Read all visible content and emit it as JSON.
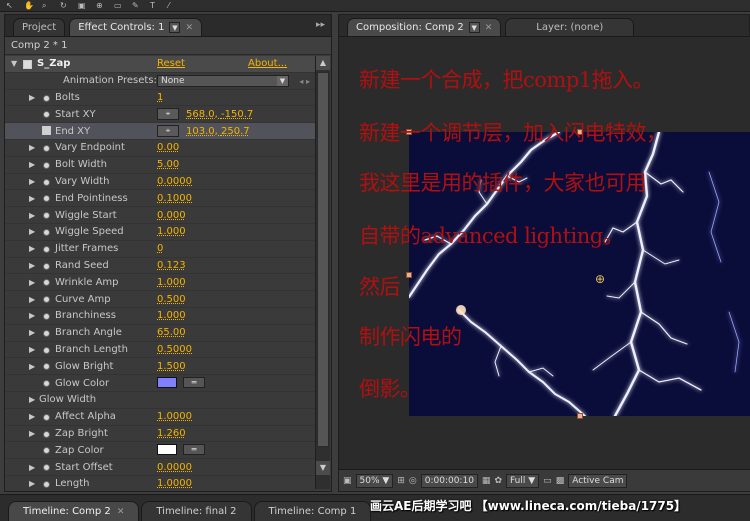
{
  "toolbar": {
    "tools": [
      "select-tool",
      "hand-tool",
      "zoom-tool",
      "rotate-tool",
      "camera-tool",
      "pan-tool",
      "rect-tool",
      "pen-tool",
      "text-tool",
      "brush-tool"
    ]
  },
  "left_panel": {
    "tabs": [
      {
        "label": "Project"
      },
      {
        "label": "Effect Controls: 1"
      }
    ],
    "comp_label": "Comp 2 * 1",
    "effect": {
      "name": "S_Zap",
      "reset": "Reset",
      "about": "About..."
    },
    "presets": {
      "label": "Animation Presets:",
      "value": "None"
    },
    "params": [
      {
        "name": "Bolts",
        "value": "1"
      },
      {
        "name": "Start XY",
        "x": "568.0",
        "y": "-150.7"
      },
      {
        "name": "End XY",
        "x": "103.0",
        "y": "250.7"
      },
      {
        "name": "Vary Endpoint",
        "value": "0.00"
      },
      {
        "name": "Bolt Width",
        "value": "5.00"
      },
      {
        "name": "Vary Width",
        "value": "0.0000"
      },
      {
        "name": "End Pointiness",
        "value": "0.1000"
      },
      {
        "name": "Wiggle Start",
        "value": "0.000"
      },
      {
        "name": "Wiggle Speed",
        "value": "1.000"
      },
      {
        "name": "Jitter Frames",
        "value": "0"
      },
      {
        "name": "Rand Seed",
        "value": "0.123"
      },
      {
        "name": "Wrinkle Amp",
        "value": "1.000"
      },
      {
        "name": "Curve Amp",
        "value": "0.500"
      },
      {
        "name": "Branchiness",
        "value": "1.000"
      },
      {
        "name": "Branch Angle",
        "value": "65.00"
      },
      {
        "name": "Branch Length",
        "value": "0.5000"
      },
      {
        "name": "Glow Bright",
        "value": "1.500"
      },
      {
        "name": "Glow Color",
        "color": "#8080ff"
      },
      {
        "name": "Glow Width"
      },
      {
        "name": "Affect Alpha",
        "value": "1.0000"
      },
      {
        "name": "Zap Bright",
        "value": "1.260"
      },
      {
        "name": "Zap Color",
        "color": "#ffffff"
      },
      {
        "name": "Start Offset",
        "value": "0.0000"
      },
      {
        "name": "Length",
        "value": "1.0000"
      }
    ]
  },
  "right_panel": {
    "tabs": [
      {
        "label": "Composition: Comp 2"
      },
      {
        "label": "Layer: (none)"
      }
    ],
    "overlay_lines": [
      "新建一个合成，把comp1拖入。",
      "新建一个调节层，加入闪电特效，",
      "我这里是用的插件，大家也可用",
      "自带的advanced lighting。",
      "然后",
      "制作闪电的",
      "倒影。"
    ],
    "viewer_bar": {
      "zoom": "50%",
      "timecode": "0:00:00:10",
      "resolution": "Full",
      "camera": "Active Cam"
    }
  },
  "bottom_tabs": [
    {
      "label": "Timeline: Comp 2"
    },
    {
      "label": "Timeline: final 2"
    },
    {
      "label": "Timeline: Comp 1"
    }
  ],
  "watermark": "画云AE后期学习吧 【www.lineca.com/tieba/1775】",
  "colors": {
    "accent_value": "#f4b400",
    "overlay_text": "#b01010",
    "comp_bg": "#0a0c3a"
  }
}
